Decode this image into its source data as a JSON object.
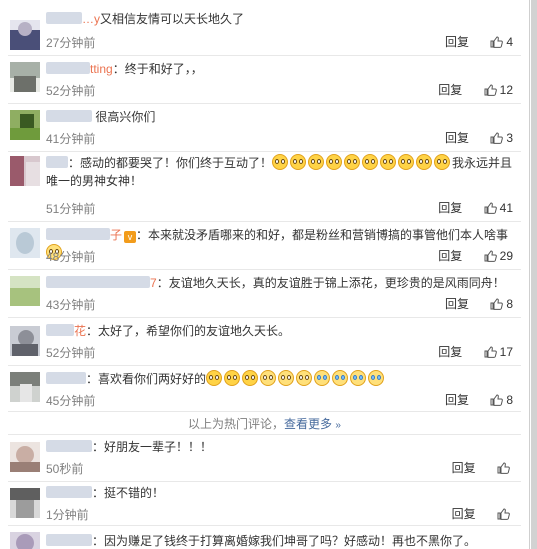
{
  "comments": [
    {
      "handle": "…y",
      "text": "又相信友情可以天长地久了",
      "time": "27分钟前",
      "reply": "回复",
      "likes": "4"
    },
    {
      "handle": "tting",
      "text": "：终于和好了，，",
      "time": "52分钟前",
      "reply": "回复",
      "likes": "12"
    },
    {
      "handle": "",
      "text": "很高兴你们",
      "time": "41分钟前",
      "reply": "回复",
      "likes": "3"
    },
    {
      "handle": "",
      "text": "：感动的都要哭了！你们终于互动了！",
      "text2": "我永远并且唯一的男神女神！",
      "time": "51分钟前",
      "reply": "回复",
      "likes": "41"
    },
    {
      "handle": "子",
      "text": "：本来就没矛盾哪来的和好，都是粉丝和营销博搞的事管他们本人啥事",
      "time": "48分钟前",
      "reply": "回复",
      "likes": "29"
    },
    {
      "handle": "7",
      "text": "：友谊地久天长，真的友谊胜于锦上添花，更珍贵的是风雨同舟！",
      "time": "43分钟前",
      "reply": "回复",
      "likes": "8"
    },
    {
      "handle": "花",
      "text": "：太好了，希望你们的友谊地久天长。",
      "time": "52分钟前",
      "reply": "回复",
      "likes": "17"
    },
    {
      "handle": "",
      "text": "：喜欢看你们两好好的",
      "time": "45分钟前",
      "reply": "回复",
      "likes": "8"
    },
    {
      "handle": "",
      "text": "：好朋友一辈子！！！",
      "time": "50秒前",
      "reply": "回复",
      "likes": ""
    },
    {
      "handle": "",
      "text": "：挺不错的！",
      "time": "1分钟前",
      "reply": "回复",
      "likes": ""
    },
    {
      "handle": "",
      "text": "：因为赚足了钱终于打算离婚嫁我们坤哥了吗？好感动！再也不黑你了。",
      "time": "",
      "reply": "",
      "likes": ""
    }
  ],
  "hot_footer": {
    "prefix": "以上为热门评论，",
    "link": "查看更多",
    "chevron": "»"
  },
  "icons": {
    "like": "thumbs-up-icon",
    "emoji": "smiley-emoji-icon",
    "vip": "vip-badge-icon"
  },
  "colors": {
    "handle": "#eb7350",
    "link": "#466a9d",
    "muted": "#808080"
  }
}
